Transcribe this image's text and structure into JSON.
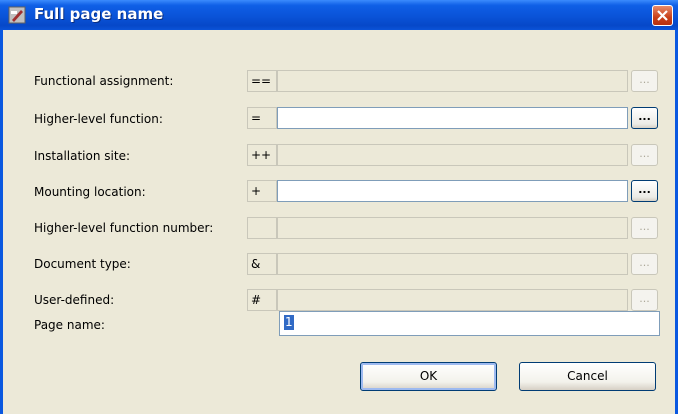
{
  "window": {
    "title": "Full page name"
  },
  "fields": [
    {
      "label": "Functional assignment:",
      "prefix": "==",
      "enabled": false
    },
    {
      "label": "Higher-level function:",
      "prefix": "=",
      "enabled": true
    },
    {
      "label": "Installation site:",
      "prefix": "++",
      "enabled": false
    },
    {
      "label": "Mounting location:",
      "prefix": "+",
      "enabled": true
    },
    {
      "label": "Higher-level function number:",
      "prefix": "",
      "enabled": false
    },
    {
      "label": "Document type:",
      "prefix": "&",
      "enabled": false
    },
    {
      "label": "User-defined:",
      "prefix": "#",
      "enabled": false
    }
  ],
  "browse_label": "...",
  "page_name": {
    "label": "Page name:",
    "value": "1"
  },
  "buttons": {
    "ok": "OK",
    "cancel": "Cancel"
  },
  "colors": {
    "title_bar": "#0a53d8",
    "dialog_bg": "#ece9d8",
    "selection": "#316ac5"
  }
}
